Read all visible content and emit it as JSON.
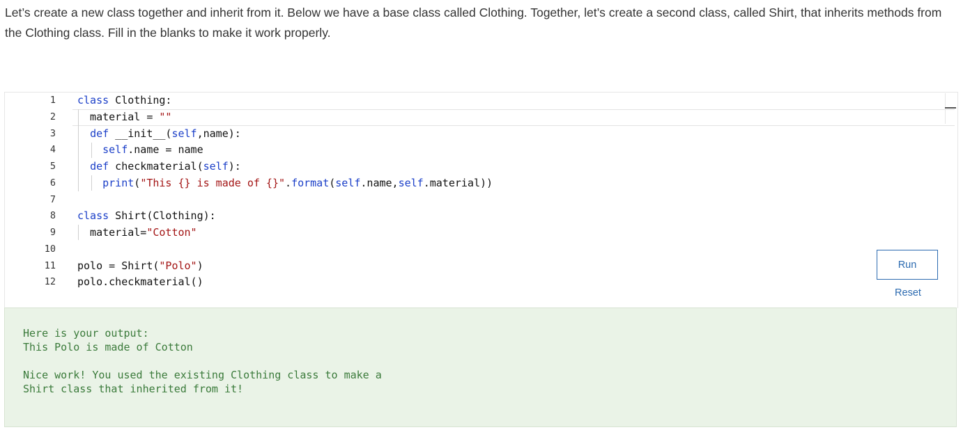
{
  "intro": "Let’s create a new class together and inherit from it. Below we have a base class called Clothing. Together, let’s create a second class, called Shirt, that inherits methods from the Clothing class. Fill in the blanks to make it work properly.",
  "editor": {
    "line_numbers": [
      "1",
      "2",
      "3",
      "4",
      "5",
      "6",
      "7",
      "8",
      "9",
      "10",
      "11",
      "12"
    ],
    "lines": [
      "class Clothing:",
      "  material = \"\"",
      "  def __init__(self,name):",
      "    self.name = name",
      "  def checkmaterial(self):",
      "    print(\"This {} is made of {}\".format(self.name,self.material))",
      "",
      "class Shirt(Clothing):",
      "  material=\"Cotton\"",
      "",
      "polo = Shirt(\"Polo\")",
      "polo.checkmaterial()"
    ]
  },
  "buttons": {
    "run": "Run",
    "reset": "Reset"
  },
  "output": {
    "text": "Here is your output:\nThis Polo is made of Cotton\n\nNice work! You used the existing Clothing class to make a\nShirt class that inherited from it!"
  },
  "colors": {
    "keyword": "#1a3ec8",
    "string": "#a31515",
    "accent": "#2b6ab0",
    "output_bg": "#eaf3e7",
    "output_text": "#3a7a3a"
  }
}
